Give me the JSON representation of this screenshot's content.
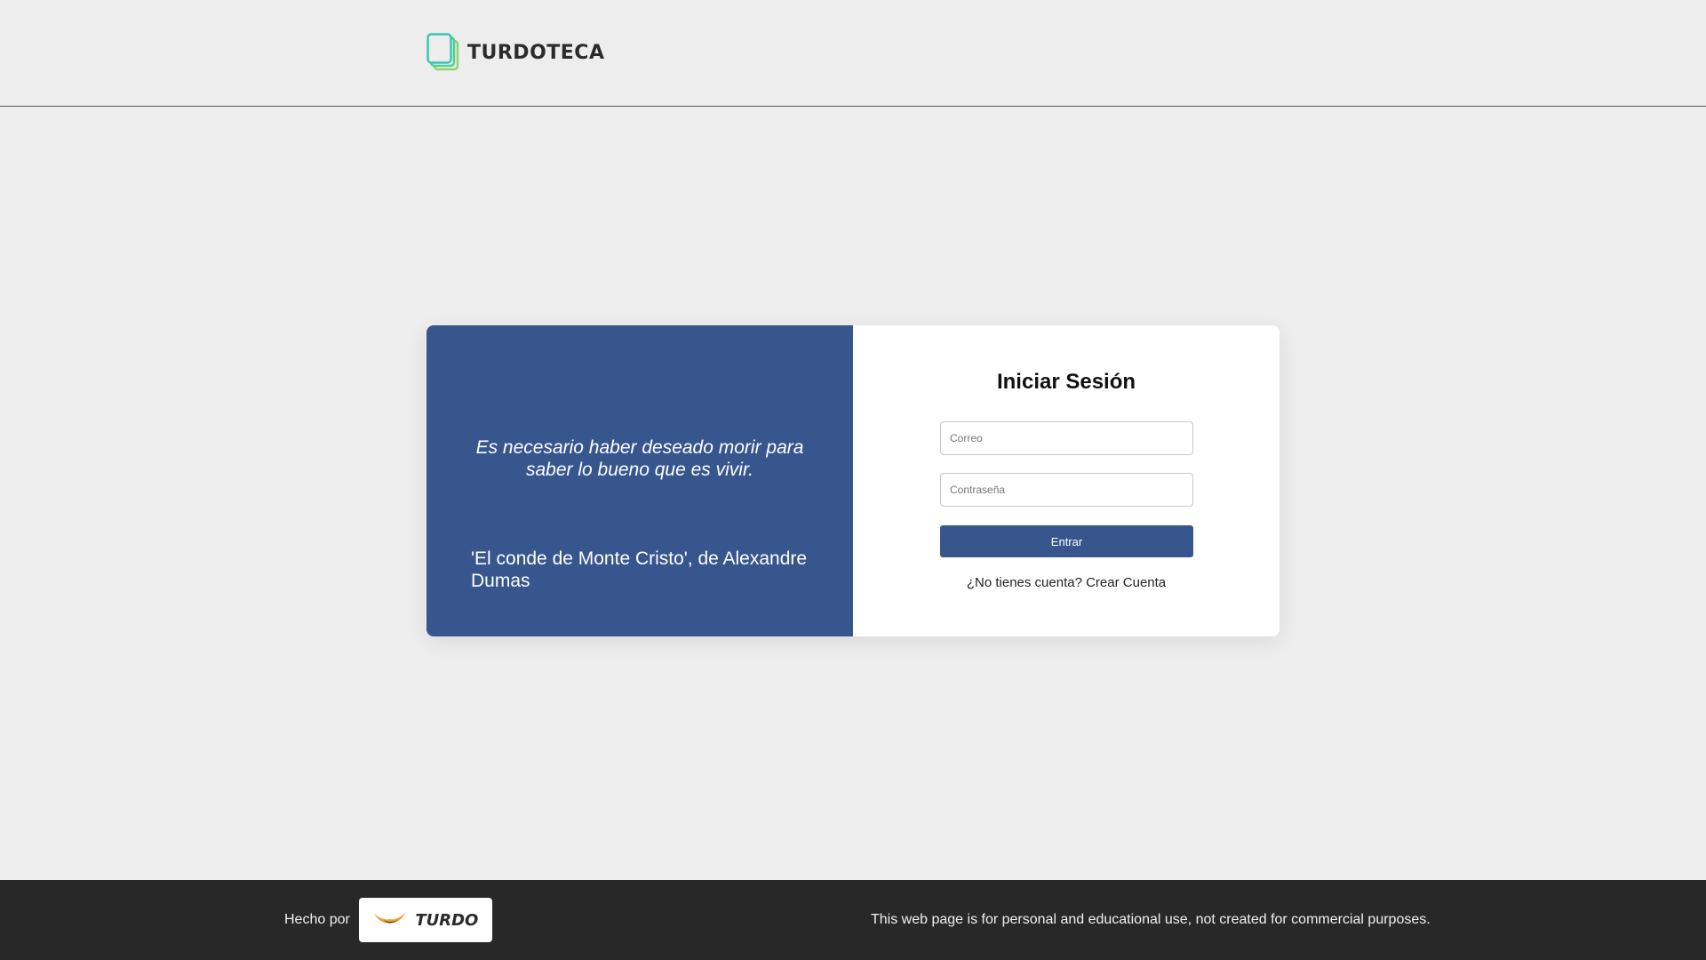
{
  "header": {
    "logo_text": "TURDOTECA"
  },
  "quote": {
    "text": "Es necesario haber deseado morir para saber lo bueno que es vivir.",
    "source": "'El conde de Monte Cristo', de Alexandre Dumas"
  },
  "login": {
    "title": "Iniciar Sesión",
    "email_placeholder": "Correo",
    "email_value": "",
    "password_placeholder": "Contraseña",
    "password_value": "",
    "submit_label": "Entrar",
    "no_account_text": "¿No tienes cuenta?",
    "create_account_label": "Crear Cuenta"
  },
  "footer": {
    "made_by_label": "Hecho por",
    "brand_text": "TURDO",
    "disclaimer": "This web page is for personal and educational use, not created for commercial purposes."
  },
  "colors": {
    "background": "#ededed",
    "primary": "#37568d",
    "footer_bg": "#282828",
    "logo_accent": "#4ccf8f"
  },
  "icons": {
    "logo": "stacked-pages-icon",
    "brand": "eagle-icon"
  }
}
